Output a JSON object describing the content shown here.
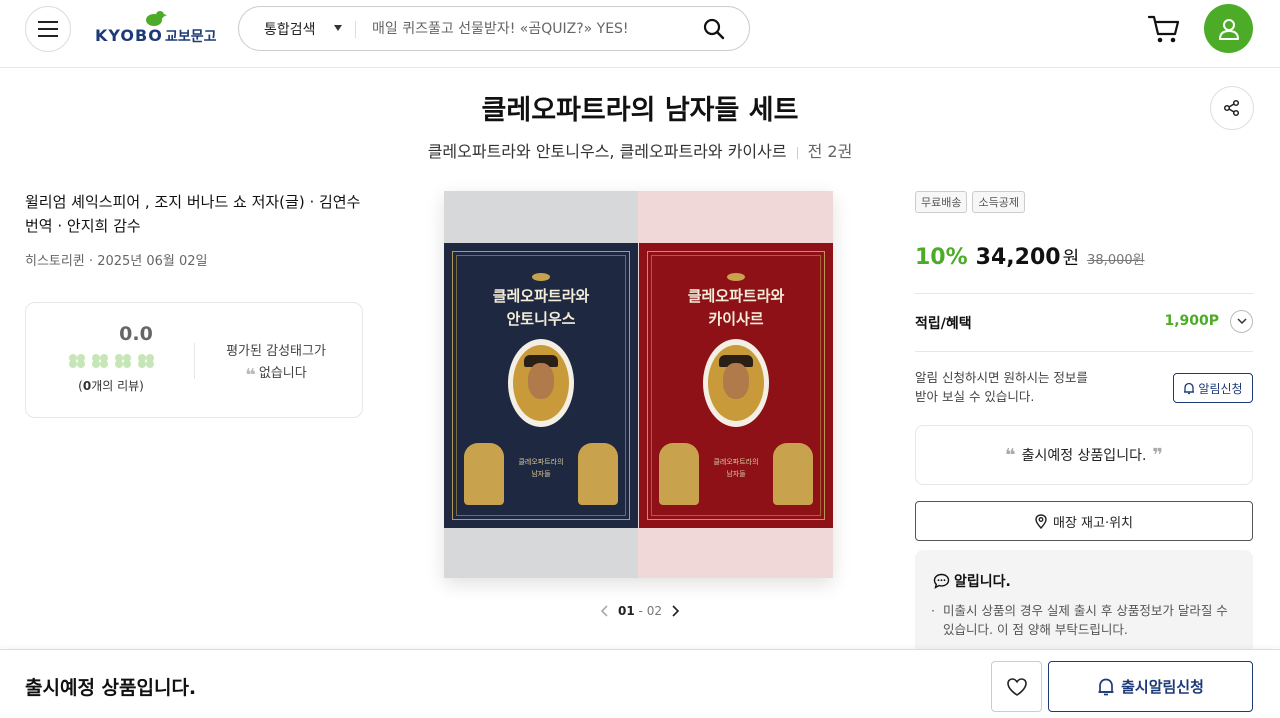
{
  "header": {
    "logo_en": "KYOBO",
    "logo_ko": "교보문고",
    "search_category": "통합검색",
    "search_placeholder": "매일 퀴즈풀고 선물받자! «곰QUIZ?» YES!"
  },
  "product": {
    "title": "클레오파트라의 남자들 세트",
    "subtitle": "클레오파트라와 안토니우스, 클레오파트라와 카이사르",
    "volumes": "전 2권",
    "author": "윌리엄 셰익스피어 , 조지 버나드 쇼 저자(글) · 김연수 번역 · 안지희 감수",
    "publisher_date": "히스토리퀸 · 2025년 06월 02일"
  },
  "review": {
    "score": "0.0",
    "count_num": "0",
    "count_suffix": "개의 리뷰)",
    "count_prefix": "(",
    "tag_line1": "평가된 감성태그가",
    "tag_line2": "없습니다"
  },
  "covers": {
    "book1_title_line1": "클레오파트라와",
    "book1_title_line2": "안토니우스",
    "book2_title_line1": "클레오파트라와",
    "book2_title_line2": "카이사르",
    "series_line1": "클레오파트라의",
    "series_line2": "남자들"
  },
  "pager": {
    "current": "01",
    "sep": "-",
    "total": "02"
  },
  "pricing": {
    "badge1": "무료배송",
    "badge2": "소득공제",
    "discount": "10%",
    "sale_price": "34,200",
    "currency": "원",
    "original_price": "38,000원",
    "points_label": "적립/혜택",
    "points_value": "1,900P"
  },
  "notify": {
    "text_line1": "알림 신청하시면 원하시는 정보를",
    "text_line2": "받아 보실 수 있습니다.",
    "button": "알림신청"
  },
  "release": {
    "text": "출시예정 상품입니다."
  },
  "store": {
    "button": "매장 재고·위치"
  },
  "notice": {
    "title": "알립니다.",
    "body": "미출시 상품의 경우 실제 출시 후 상품정보가 달라질 수 있습니다. 이 점 양해 부탁드립니다."
  },
  "bottom": {
    "status": "출시예정 상품입니다.",
    "notify_button": "출시알림신청"
  },
  "colors": {
    "brand_green": "#4dac27",
    "brand_navy": "#1d3a78"
  }
}
